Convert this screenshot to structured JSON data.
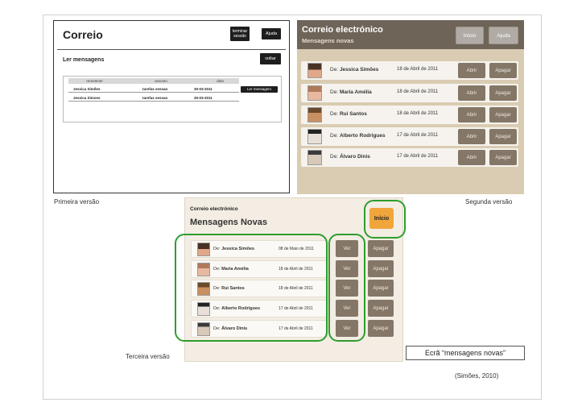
{
  "v1": {
    "title": "Correio",
    "btn_terminar": "terminar sessão",
    "btn_ajuda": "Ajuda",
    "subtitle": "Ler mensagens",
    "btn_voltar": "voltar",
    "columns": [
      "remetente",
      "assunto",
      "data"
    ],
    "rows": [
      {
        "remetente": "Jessica Simões",
        "assunto": "tarefas sessao",
        "data": "30-03-2011"
      },
      {
        "remetente": "Jessica Simoes",
        "assunto": "tarefas sessao",
        "data": "30-03-2011"
      }
    ],
    "btn_ler": "Ler mensagem"
  },
  "v2": {
    "title": "Correio electrónico",
    "subtitle": "Mensagens novas",
    "btn_inicio": "Início",
    "btn_ajuda": "Ajuda",
    "de_prefix": "De:",
    "btn_abrir": "Abrir",
    "btn_apagar": "Apagar",
    "messages": [
      {
        "name": "Jessica Simões",
        "date": "18 de Abril de 2011"
      },
      {
        "name": "Maria Amélia",
        "date": "18 de Abril de 2011"
      },
      {
        "name": "Rui Santos",
        "date": "18 de Abril de 2011"
      },
      {
        "name": "Alberto Rodrigues",
        "date": "17 de Abril de 2011"
      },
      {
        "name": "Álvaro Dinis",
        "date": "17 de Abril de 2011"
      }
    ]
  },
  "v3": {
    "title": "Correio electrónico",
    "subtitle": "Mensagens Novas",
    "btn_inicio": "Início",
    "de_prefix": "De:",
    "btn_ver": "Ver",
    "btn_apagar": "Apagar",
    "messages": [
      {
        "name": "Jessica Simões",
        "date": "08 de Maio de 2011"
      },
      {
        "name": "Maria Amélia",
        "date": "18 de Abril de 2011"
      },
      {
        "name": "Rui Santos",
        "date": "18 de Abril de 2011"
      },
      {
        "name": "Alberto Rodrigues",
        "date": "17 de Abril de 2011"
      },
      {
        "name": "Álvaro Dinis",
        "date": "17 de Abril de 2011"
      }
    ]
  },
  "labels": {
    "primeira": "Primeira versão",
    "segunda": "Segunda versão",
    "terceira": "Terceira versão",
    "caption": "Ecrã “mensagens novas”",
    "citation": "(Simões, 2010)"
  },
  "colors": {
    "highlight": "#2e9d2e",
    "orange_button": "#f0a63b",
    "header_brown": "#6f6458",
    "panel_beige": "#d9ccb2"
  }
}
